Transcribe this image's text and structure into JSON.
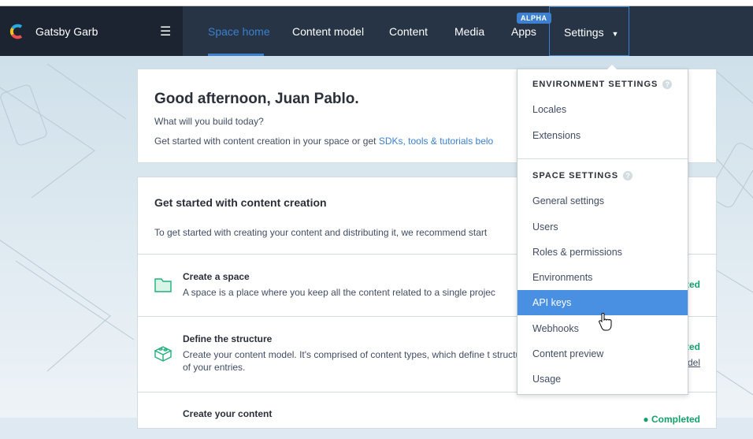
{
  "app": {
    "space_name": "Gatsby Garb"
  },
  "nav": {
    "tabs": [
      {
        "label": "Space home",
        "active": true
      },
      {
        "label": "Content model"
      },
      {
        "label": "Content"
      },
      {
        "label": "Media"
      },
      {
        "label": "Apps",
        "badge": "ALPHA"
      }
    ],
    "settings_label": "Settings"
  },
  "welcome": {
    "title": "Good afternoon, Juan Pablo.",
    "subtitle": "What will you build today?",
    "body": "Get started with content creation in your space or get ",
    "link": "SDKs, tools & tutorials belo"
  },
  "getting_started": {
    "title": "Get started with content creation",
    "intro": "To get started with creating your content and distributing it, we recommend start",
    "steps": [
      {
        "title": "Create a space",
        "desc": "A space is a place where you keep all the content related to a single projec",
        "status": "Completed",
        "icon": "folder-icon"
      },
      {
        "title": "Define the structure",
        "desc": "Create your content model. It's comprised of content types, which define t structure of your entries.",
        "status": "Completed",
        "link": "content model",
        "icon": "lego-brick-icon"
      },
      {
        "title": "Create your content",
        "status": "Completed"
      }
    ]
  },
  "dropdown": {
    "env_header": "ENVIRONMENT SETTINGS",
    "env_items": [
      "Locales",
      "Extensions"
    ],
    "space_header": "SPACE SETTINGS",
    "space_items": [
      "General settings",
      "Users",
      "Roles & permissions",
      "Environments",
      "API keys",
      "Webhooks",
      "Content preview",
      "Usage"
    ],
    "highlighted": "API keys"
  },
  "colors": {
    "accent": "#3c80cf",
    "nav": "#263445",
    "success": "#14a06b",
    "highlight": "#4a90e2"
  }
}
